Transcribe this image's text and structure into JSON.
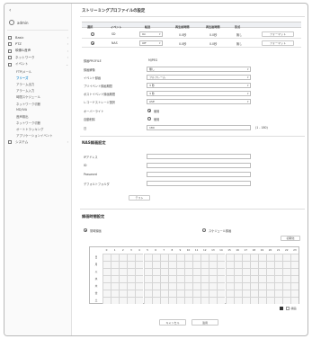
{
  "sidebar": {
    "back_glyph": "‹",
    "user": "admin",
    "menu": [
      {
        "label": "Basic",
        "icon": "grid-icon",
        "chevron": "›"
      },
      {
        "label": "PTZ",
        "icon": "move-icon",
        "chevron": "›"
      },
      {
        "label": "映像&音声",
        "icon": "video-icon",
        "chevron": "›"
      },
      {
        "label": "ネットワーク",
        "icon": "network-icon",
        "chevron": "›"
      },
      {
        "label": "イベント",
        "icon": "event-icon",
        "chevron": "⌄"
      }
    ],
    "submenu": [
      "FTP/メール",
      "フリーズ",
      "アラーム出力",
      "アラーム入力",
      "時間スケジュール",
      "ネットワーク切断",
      "MD/IVA",
      "音声検出",
      "ネットワーク切断",
      "オートトラッキング",
      "アプリケーションイベント"
    ],
    "system": {
      "label": "システム",
      "icon": "system-icon",
      "chevron": "›"
    }
  },
  "page_title": "ストリーミングプロファイルの設定",
  "table": {
    "headers": [
      "選択",
      "イベント",
      "転送",
      "再生前時間",
      "再生後時間",
      "形式",
      ""
    ],
    "rows": [
      {
        "selected": false,
        "event": "SD",
        "transfer": "On",
        "pre": "0.0秒",
        "post": "0.0秒",
        "format": "無し",
        "button": "フォーマット"
      },
      {
        "selected": true,
        "event": "NAS",
        "transfer": "Off",
        "pre": "0.0秒",
        "post": "0.0秒",
        "format": "無し",
        "button": "フォーマット"
      }
    ]
  },
  "settings": {
    "profile_label": "録画PROFILE",
    "profile_value": "MJPEG",
    "rows": [
      {
        "label": "録画解像",
        "value": "無し"
      },
      {
        "label": "イベント録画",
        "value": "フルフレーム"
      },
      {
        "label": "プリイベント録画期間",
        "value": "3 秒"
      },
      {
        "label": "ポストイベント録画期間",
        "value": "3 秒"
      },
      {
        "label": "レコードストレージ選択",
        "value": "ASE"
      }
    ],
    "overwrite_label": "オーバーライト",
    "overwrite_value": "使用",
    "autodelete_label": "自動削除",
    "autodelete_value": "使用",
    "days_label": "日",
    "days_value": "180",
    "days_range": "(1 - 180)"
  },
  "nas": {
    "title": "NAS録画設定",
    "fields": [
      {
        "label": "IPアドレス",
        "value": ""
      },
      {
        "label": "ID",
        "value": ""
      },
      {
        "label": "Password",
        "value": ""
      },
      {
        "label": "デフォルトフォルダ",
        "value": ""
      }
    ],
    "test_button": "テスト"
  },
  "schedule": {
    "title": "録画時間設定",
    "option_always": "常時録画",
    "option_schedule": "スケジュール録画",
    "clear_button": "初期化",
    "hours": [
      "0",
      "1",
      "2",
      "3",
      "4",
      "5",
      "6",
      "7",
      "8",
      "9",
      "10",
      "11",
      "12",
      "13",
      "14",
      "15",
      "16",
      "17",
      "18",
      "19",
      "20",
      "21",
      "22",
      "23"
    ],
    "days": [
      "日",
      "月",
      "火",
      "水",
      "木",
      "金",
      "土"
    ],
    "legend": [
      {
        "label": "",
        "color": "#333333"
      },
      {
        "label": "録画",
        "color": "#ffffff"
      }
    ]
  },
  "footer": {
    "cancel": "キャンセル",
    "apply": "適用"
  }
}
